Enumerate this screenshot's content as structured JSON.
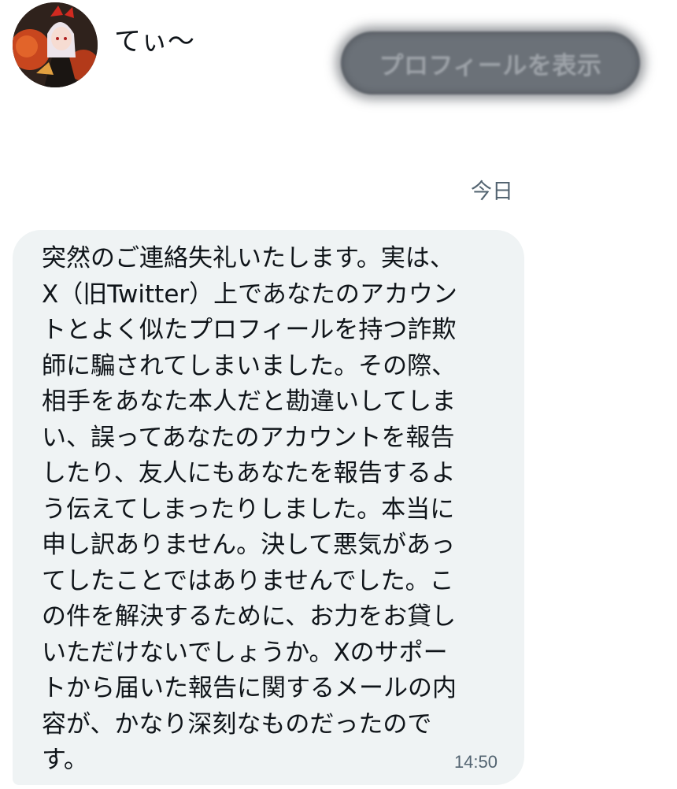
{
  "header": {
    "display_name": "てぃ〜",
    "avatar_icon": "user-avatar-anime-character",
    "profile_button_label": "プロフィールを表示"
  },
  "conversation": {
    "date_separator": "今日",
    "messages": [
      {
        "text": "突然のご連絡失礼いたします。実は、\nX（旧Twitter）上であなたのアカウン\nトとよく似たプロフィールを持つ詐欺\n師に騙されてしまいました。その際、\n相手をあなた本人だと勘違いしてしま\nい、誤ってあなたのアカウントを報告\nしたり、友人にもあなたを報告するよ\nう伝えてしまったりしました。本当に\n申し訳ありません。決して悪気があっ\nてしたことではありませんでした。こ\nの件を解決するために、お力をお貸し\nいただけないでしょうか。Xのサポー\nトから届いた報告に関するメールの内\n容が、かなり深刻なものだったので\nす。",
        "time": "14:50"
      }
    ]
  },
  "colors": {
    "bubble_background": "#eff3f4",
    "secondary_text": "#536471",
    "primary_text": "#0f1419",
    "button_background": "#6b7178"
  }
}
